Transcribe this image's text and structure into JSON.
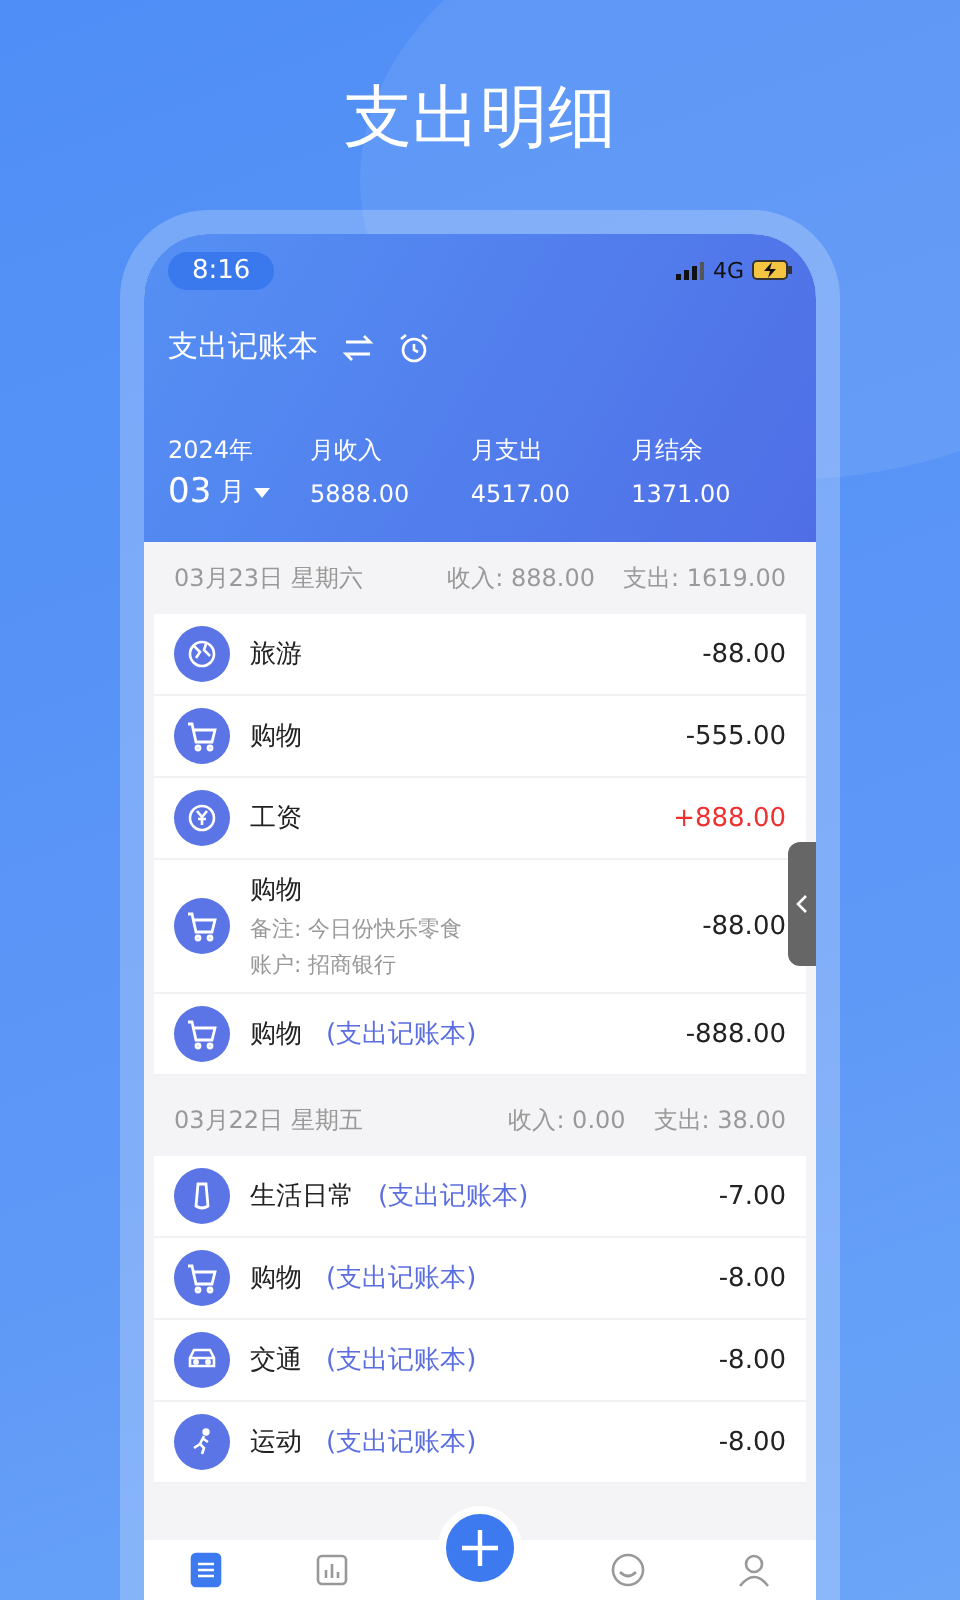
{
  "page_title": "支出明细",
  "status_bar": {
    "time": "8:16",
    "network": "4G"
  },
  "header": {
    "book_title": "支出记账本",
    "year": "2024年",
    "month": "03",
    "month_unit": "月",
    "stats": [
      {
        "label": "月收入",
        "value": "5888.00"
      },
      {
        "label": "月支出",
        "value": "4517.00"
      },
      {
        "label": "月结余",
        "value": "1371.00"
      }
    ]
  },
  "days": [
    {
      "date": "03月23日 星期六",
      "income": "收入: 888.00",
      "expense": "支出: 1619.00",
      "entries": [
        {
          "kind": "globe",
          "category": "旅游",
          "income": false,
          "amount": "-88.00"
        },
        {
          "kind": "cart",
          "category": "购物",
          "income": false,
          "amount": "-555.00"
        },
        {
          "kind": "yen",
          "category": "工资",
          "income": true,
          "amount": "+888.00"
        },
        {
          "kind": "cart",
          "category": "购物",
          "income": false,
          "amount": "-88.00",
          "notes": [
            "备注: 今日份快乐零食",
            "账户: 招商银行"
          ]
        },
        {
          "kind": "cart",
          "category": "购物",
          "book": "(支出记账本)",
          "income": false,
          "amount": "-888.00"
        }
      ]
    },
    {
      "date": "03月22日 星期五",
      "income": "收入: 0.00",
      "expense": "支出: 38.00",
      "entries": [
        {
          "kind": "bottle",
          "category": "生活日常",
          "book": "(支出记账本)",
          "income": false,
          "amount": "-7.00"
        },
        {
          "kind": "cart",
          "category": "购物",
          "book": "(支出记账本)",
          "income": false,
          "amount": "-8.00"
        },
        {
          "kind": "car",
          "category": "交通",
          "book": "(支出记账本)",
          "income": false,
          "amount": "-8.00"
        },
        {
          "kind": "run",
          "category": "运动",
          "book": "(支出记账本)",
          "income": false,
          "amount": "-8.00"
        }
      ]
    }
  ],
  "tabs": [
    {
      "kind": "list",
      "selected": true
    },
    {
      "kind": "chart",
      "selected": false
    },
    {
      "kind": "add",
      "selected": false
    },
    {
      "kind": "smile",
      "selected": false
    },
    {
      "kind": "user",
      "selected": false
    }
  ]
}
